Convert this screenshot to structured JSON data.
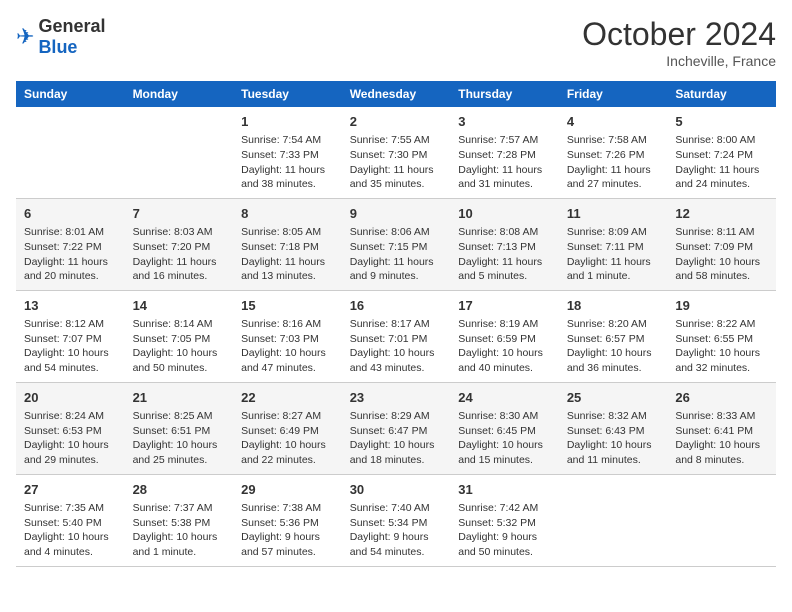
{
  "header": {
    "logo": {
      "general": "General",
      "blue": "Blue"
    },
    "month": "October 2024",
    "location": "Incheville, France"
  },
  "days_of_week": [
    "Sunday",
    "Monday",
    "Tuesday",
    "Wednesday",
    "Thursday",
    "Friday",
    "Saturday"
  ],
  "weeks": [
    [
      {
        "day": "",
        "info": ""
      },
      {
        "day": "",
        "info": ""
      },
      {
        "day": "1",
        "info": "Sunrise: 7:54 AM\nSunset: 7:33 PM\nDaylight: 11 hours and 38 minutes."
      },
      {
        "day": "2",
        "info": "Sunrise: 7:55 AM\nSunset: 7:30 PM\nDaylight: 11 hours and 35 minutes."
      },
      {
        "day": "3",
        "info": "Sunrise: 7:57 AM\nSunset: 7:28 PM\nDaylight: 11 hours and 31 minutes."
      },
      {
        "day": "4",
        "info": "Sunrise: 7:58 AM\nSunset: 7:26 PM\nDaylight: 11 hours and 27 minutes."
      },
      {
        "day": "5",
        "info": "Sunrise: 8:00 AM\nSunset: 7:24 PM\nDaylight: 11 hours and 24 minutes."
      }
    ],
    [
      {
        "day": "6",
        "info": "Sunrise: 8:01 AM\nSunset: 7:22 PM\nDaylight: 11 hours and 20 minutes."
      },
      {
        "day": "7",
        "info": "Sunrise: 8:03 AM\nSunset: 7:20 PM\nDaylight: 11 hours and 16 minutes."
      },
      {
        "day": "8",
        "info": "Sunrise: 8:05 AM\nSunset: 7:18 PM\nDaylight: 11 hours and 13 minutes."
      },
      {
        "day": "9",
        "info": "Sunrise: 8:06 AM\nSunset: 7:15 PM\nDaylight: 11 hours and 9 minutes."
      },
      {
        "day": "10",
        "info": "Sunrise: 8:08 AM\nSunset: 7:13 PM\nDaylight: 11 hours and 5 minutes."
      },
      {
        "day": "11",
        "info": "Sunrise: 8:09 AM\nSunset: 7:11 PM\nDaylight: 11 hours and 1 minute."
      },
      {
        "day": "12",
        "info": "Sunrise: 8:11 AM\nSunset: 7:09 PM\nDaylight: 10 hours and 58 minutes."
      }
    ],
    [
      {
        "day": "13",
        "info": "Sunrise: 8:12 AM\nSunset: 7:07 PM\nDaylight: 10 hours and 54 minutes."
      },
      {
        "day": "14",
        "info": "Sunrise: 8:14 AM\nSunset: 7:05 PM\nDaylight: 10 hours and 50 minutes."
      },
      {
        "day": "15",
        "info": "Sunrise: 8:16 AM\nSunset: 7:03 PM\nDaylight: 10 hours and 47 minutes."
      },
      {
        "day": "16",
        "info": "Sunrise: 8:17 AM\nSunset: 7:01 PM\nDaylight: 10 hours and 43 minutes."
      },
      {
        "day": "17",
        "info": "Sunrise: 8:19 AM\nSunset: 6:59 PM\nDaylight: 10 hours and 40 minutes."
      },
      {
        "day": "18",
        "info": "Sunrise: 8:20 AM\nSunset: 6:57 PM\nDaylight: 10 hours and 36 minutes."
      },
      {
        "day": "19",
        "info": "Sunrise: 8:22 AM\nSunset: 6:55 PM\nDaylight: 10 hours and 32 minutes."
      }
    ],
    [
      {
        "day": "20",
        "info": "Sunrise: 8:24 AM\nSunset: 6:53 PM\nDaylight: 10 hours and 29 minutes."
      },
      {
        "day": "21",
        "info": "Sunrise: 8:25 AM\nSunset: 6:51 PM\nDaylight: 10 hours and 25 minutes."
      },
      {
        "day": "22",
        "info": "Sunrise: 8:27 AM\nSunset: 6:49 PM\nDaylight: 10 hours and 22 minutes."
      },
      {
        "day": "23",
        "info": "Sunrise: 8:29 AM\nSunset: 6:47 PM\nDaylight: 10 hours and 18 minutes."
      },
      {
        "day": "24",
        "info": "Sunrise: 8:30 AM\nSunset: 6:45 PM\nDaylight: 10 hours and 15 minutes."
      },
      {
        "day": "25",
        "info": "Sunrise: 8:32 AM\nSunset: 6:43 PM\nDaylight: 10 hours and 11 minutes."
      },
      {
        "day": "26",
        "info": "Sunrise: 8:33 AM\nSunset: 6:41 PM\nDaylight: 10 hours and 8 minutes."
      }
    ],
    [
      {
        "day": "27",
        "info": "Sunrise: 7:35 AM\nSunset: 5:40 PM\nDaylight: 10 hours and 4 minutes."
      },
      {
        "day": "28",
        "info": "Sunrise: 7:37 AM\nSunset: 5:38 PM\nDaylight: 10 hours and 1 minute."
      },
      {
        "day": "29",
        "info": "Sunrise: 7:38 AM\nSunset: 5:36 PM\nDaylight: 9 hours and 57 minutes."
      },
      {
        "day": "30",
        "info": "Sunrise: 7:40 AM\nSunset: 5:34 PM\nDaylight: 9 hours and 54 minutes."
      },
      {
        "day": "31",
        "info": "Sunrise: 7:42 AM\nSunset: 5:32 PM\nDaylight: 9 hours and 50 minutes."
      },
      {
        "day": "",
        "info": ""
      },
      {
        "day": "",
        "info": ""
      }
    ]
  ]
}
